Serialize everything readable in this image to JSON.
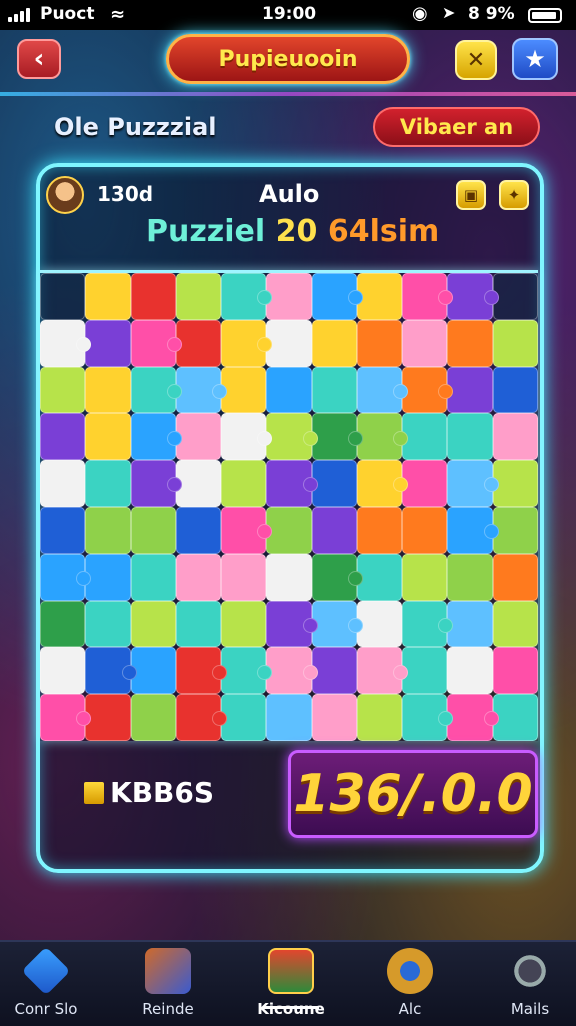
{
  "status_bar": {
    "carrier": "Puoct",
    "time": "19:00",
    "battery": "8 9%"
  },
  "header": {
    "title": "Pupieuooin"
  },
  "subheader": {
    "left": "Ole Puzzzial",
    "button": "Vibaer an"
  },
  "board": {
    "top_count": "130d",
    "mode": "Aulo",
    "puzzle_line": [
      "Puzziel",
      "20",
      "64lsim"
    ],
    "gem_label": "KBB6S",
    "score": "136/.0.0"
  },
  "nav": [
    {
      "label": "Conr Slo",
      "icon": "cube-icon"
    },
    {
      "label": "Reinde",
      "icon": "book-icon"
    },
    {
      "label": "Kicoune",
      "icon": "chest-icon"
    },
    {
      "label": "Alc",
      "icon": "gear-icon"
    },
    {
      "label": "Mails",
      "icon": "magnifier-icon"
    }
  ],
  "colors": {
    "accent_cyan": "#7ff6ff",
    "title_red": "#c8262a",
    "gold": "#ffd43a",
    "score_purple": "#6d1d78"
  }
}
